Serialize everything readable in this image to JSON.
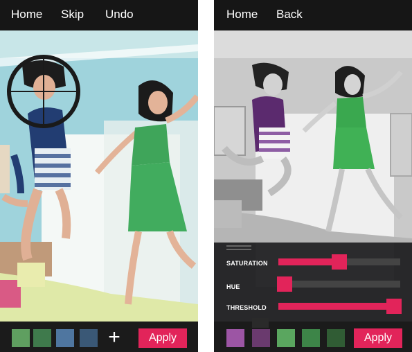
{
  "left_screen": {
    "nav": {
      "home": "Home",
      "skip": "Skip",
      "undo": "Undo"
    },
    "swatches": [
      "#5f9f60",
      "#3f7a4c",
      "#4f76a0",
      "#3a5876"
    ],
    "apply": "Apply"
  },
  "right_screen": {
    "nav": {
      "home": "Home",
      "back": "Back"
    },
    "sliders": [
      {
        "label": "SATURATION",
        "value": 0.5
      },
      {
        "label": "HUE",
        "value": 0.05
      },
      {
        "label": "THRESHOLD",
        "value": 0.95
      }
    ],
    "swatches": [
      "#9c55a4",
      "#6a3a6e",
      "#5aa65f",
      "#3d8548",
      "#305c34"
    ],
    "apply": "Apply"
  },
  "colors": {
    "accent": "#e2245a"
  }
}
